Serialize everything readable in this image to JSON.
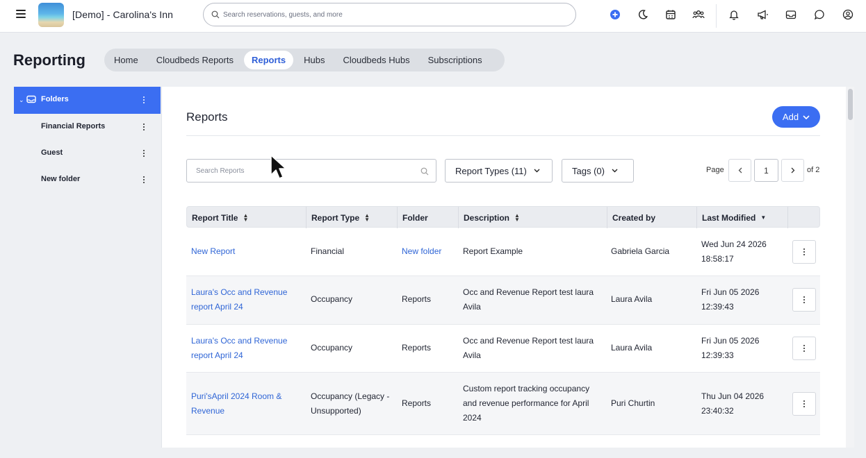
{
  "topbar": {
    "property_name": "[Demo] - Carolina's Inn",
    "search_placeholder": "Search reservations, guests, and more"
  },
  "header": {
    "title": "Reporting",
    "tabs": [
      {
        "label": "Home"
      },
      {
        "label": "Cloudbeds Reports"
      },
      {
        "label": "Reports"
      },
      {
        "label": "Hubs"
      },
      {
        "label": "Cloudbeds Hubs"
      },
      {
        "label": "Subscriptions"
      }
    ]
  },
  "sidebar": {
    "root_label": "Folders",
    "items": [
      {
        "label": "Financial Reports"
      },
      {
        "label": "Guest"
      },
      {
        "label": "New folder"
      }
    ]
  },
  "main": {
    "title": "Reports",
    "add_label": "Add",
    "search_placeholder": "Search Reports",
    "report_types_label": "Report Types (11)",
    "tags_label": "Tags (0)",
    "page_label": "Page",
    "page_value": "1",
    "page_of": "of 2"
  },
  "table": {
    "headers": {
      "title": "Report Title",
      "type": "Report Type",
      "folder": "Folder",
      "description": "Description",
      "created_by": "Created by",
      "modified": "Last Modified"
    },
    "rows": [
      {
        "title": [
          "New Report"
        ],
        "type": [
          "Financial"
        ],
        "folder": "New folder",
        "folder_link": true,
        "description": [
          "Report Example"
        ],
        "created_by": "Gabriela Garcia",
        "modified": [
          "Wed Jun 24 2026",
          "18:58:17"
        ]
      },
      {
        "title": [
          "Laura's Occ and Revenue",
          "report April 24"
        ],
        "type": [
          "Occupancy"
        ],
        "folder": "Reports",
        "folder_link": false,
        "description": [
          "Occ and Revenue Report test laura",
          "Avila"
        ],
        "created_by": "Laura Avila",
        "modified": [
          "Fri Jun 05 2026",
          "12:39:43"
        ]
      },
      {
        "title": [
          "Laura's Occ and Revenue",
          "report April 24"
        ],
        "type": [
          "Occupancy"
        ],
        "folder": "Reports",
        "folder_link": false,
        "description": [
          "Occ and Revenue Report test laura",
          "Avila"
        ],
        "created_by": "Laura Avila",
        "modified": [
          "Fri Jun 05 2026",
          "12:39:33"
        ]
      },
      {
        "title": [
          "Puri'sApril 2024 Room &",
          "Revenue"
        ],
        "type": [
          "Occupancy (Legacy -",
          "Unsupported)"
        ],
        "folder": "Reports",
        "folder_link": false,
        "description": [
          "Custom report tracking occupancy",
          "and revenue performance for April",
          "2024"
        ],
        "created_by": "Puri Churtin",
        "modified": [
          "Thu Jun 04 2026",
          "23:40:32"
        ]
      }
    ]
  },
  "colors": {
    "accent": "#3b6ef2",
    "link": "#2f65d6",
    "stripe": "#f5f6f8"
  }
}
